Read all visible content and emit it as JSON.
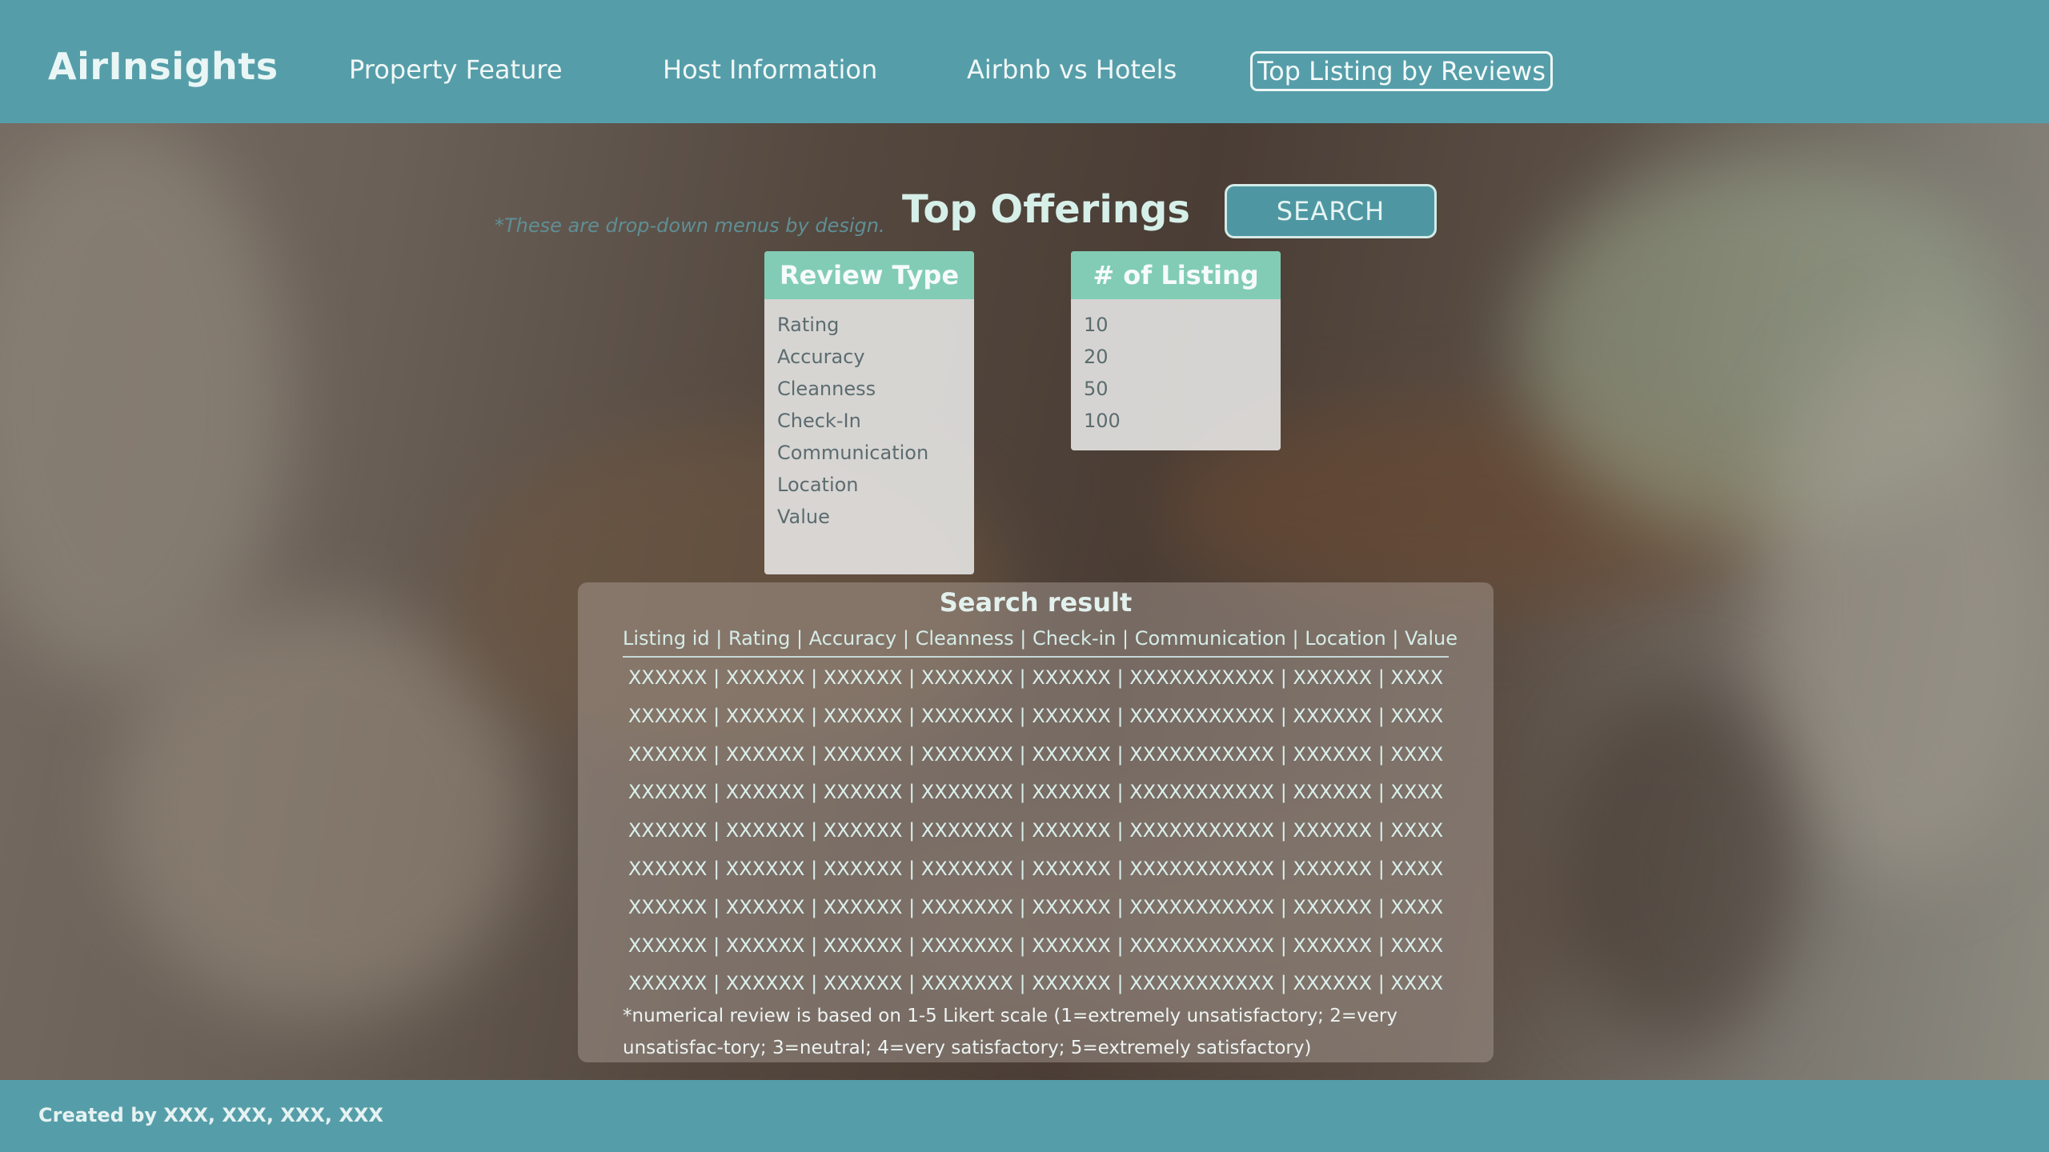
{
  "app": {
    "logo": "AirInsights"
  },
  "nav": {
    "items": [
      {
        "label": "Property Feature"
      },
      {
        "label": "Host Information"
      },
      {
        "label": "Airbnb vs Hotels"
      },
      {
        "label": "Top Listing by Reviews"
      }
    ],
    "active_index": 3
  },
  "main": {
    "hint": "*These are drop-down menus by design.",
    "title": "Top Offerings",
    "search_label": "SEARCH",
    "review_type": {
      "header": "Review Type",
      "options": [
        "Rating",
        "Accuracy",
        "Cleanness",
        "Check-In",
        "Communication",
        "Location",
        "Value"
      ]
    },
    "num_listing": {
      "header": "# of Listing",
      "options": [
        "10",
        "20",
        "50",
        "100"
      ]
    },
    "results": {
      "title": "Search result",
      "header": "Listing id | Rating | Accuracy | Cleanness | Check-in | Communication | Location | Value",
      "rows": [
        "XXXXXX | XXXXXX | XXXXXX | XXXXXXX | XXXXXX | XXXXXXXXXXX | XXXXXX | XXXX",
        "XXXXXX | XXXXXX | XXXXXX | XXXXXXX | XXXXXX | XXXXXXXXXXX | XXXXXX | XXXX",
        "XXXXXX | XXXXXX | XXXXXX | XXXXXXX | XXXXXX | XXXXXXXXXXX | XXXXXX | XXXX",
        "XXXXXX | XXXXXX | XXXXXX | XXXXXXX | XXXXXX | XXXXXXXXXXX | XXXXXX | XXXX",
        "XXXXXX | XXXXXX | XXXXXX | XXXXXXX | XXXXXX | XXXXXXXXXXX | XXXXXX | XXXX",
        "XXXXXX | XXXXXX | XXXXXX | XXXXXXX | XXXXXX | XXXXXXXXXXX | XXXXXX | XXXX",
        "XXXXXX | XXXXXX | XXXXXX | XXXXXXX | XXXXXX | XXXXXXXXXXX | XXXXXX | XXXX",
        "XXXXXX | XXXXXX | XXXXXX | XXXXXXX | XXXXXX | XXXXXXXXXXX | XXXXXX | XXXX",
        "XXXXXX | XXXXXX | XXXXXX | XXXXXXX | XXXXXX | XXXXXXXXXXX | XXXXXX | XXXX"
      ],
      "note": "*numerical review is based on 1-5 Likert scale (1=extremely unsatisfactory; 2=very unsatisfac-tory; 3=neutral; 4=very satisfactory; 5=extremely satisfactory)"
    }
  },
  "footer": {
    "credit": "Created by XXX, XXX, XXX, XXX"
  },
  "colors": {
    "header_bg": "#559ea9",
    "dropdown_header": "#82ccb6",
    "title_text": "#d6efe9"
  }
}
